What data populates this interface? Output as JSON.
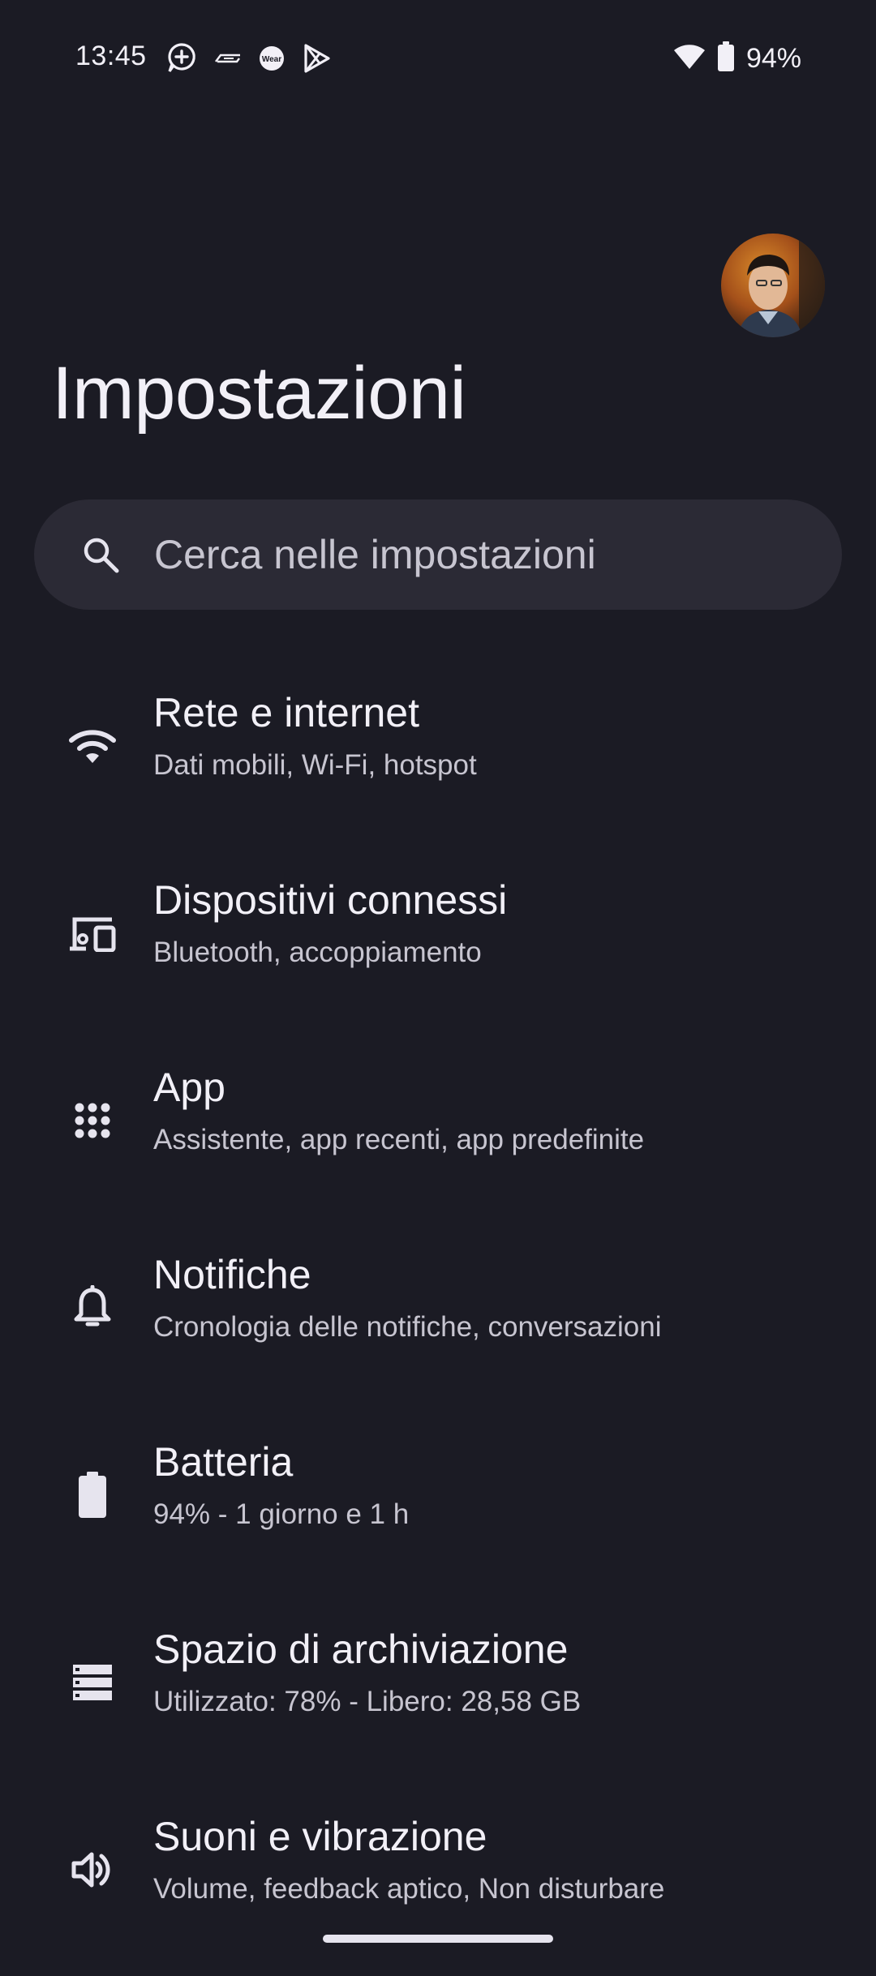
{
  "status_bar": {
    "time": "13:45",
    "battery_percent": "94%",
    "notification_icons": [
      "assistant-plus-icon",
      "brand-logo-icon",
      "wear-os-icon",
      "play-store-icon"
    ],
    "wear_label": "Wear",
    "wifi_icon": "wifi-icon",
    "battery_icon": "battery-icon"
  },
  "header": {
    "title": "Impostazioni",
    "avatar_icon": "profile-avatar"
  },
  "search": {
    "placeholder": "Cerca nelle impostazioni",
    "icon": "search-icon"
  },
  "settings": [
    {
      "title": "Rete e internet",
      "subtitle": "Dati mobili, Wi-Fi, hotspot",
      "icon": "wifi-icon"
    },
    {
      "title": "Dispositivi connessi",
      "subtitle": "Bluetooth, accoppiamento",
      "icon": "connected-devices-icon"
    },
    {
      "title": "App",
      "subtitle": "Assistente, app recenti, app predefinite",
      "icon": "apps-grid-icon"
    },
    {
      "title": "Notifiche",
      "subtitle": "Cronologia delle notifiche, conversazioni",
      "icon": "bell-icon"
    },
    {
      "title": "Batteria",
      "subtitle": "94% - 1 giorno e 1 h",
      "icon": "battery-icon"
    },
    {
      "title": "Spazio di archiviazione",
      "subtitle": "Utilizzato: 78% - Libero: 28,58 GB",
      "icon": "storage-icon"
    },
    {
      "title": "Suoni e vibrazione",
      "subtitle": "Volume, feedback aptico, Non disturbare",
      "icon": "volume-icon"
    }
  ],
  "colors": {
    "background": "#1b1b24",
    "search_background": "#2b2a35",
    "primary_text": "#f2f0f7",
    "secondary_text": "#c7c5d0"
  }
}
